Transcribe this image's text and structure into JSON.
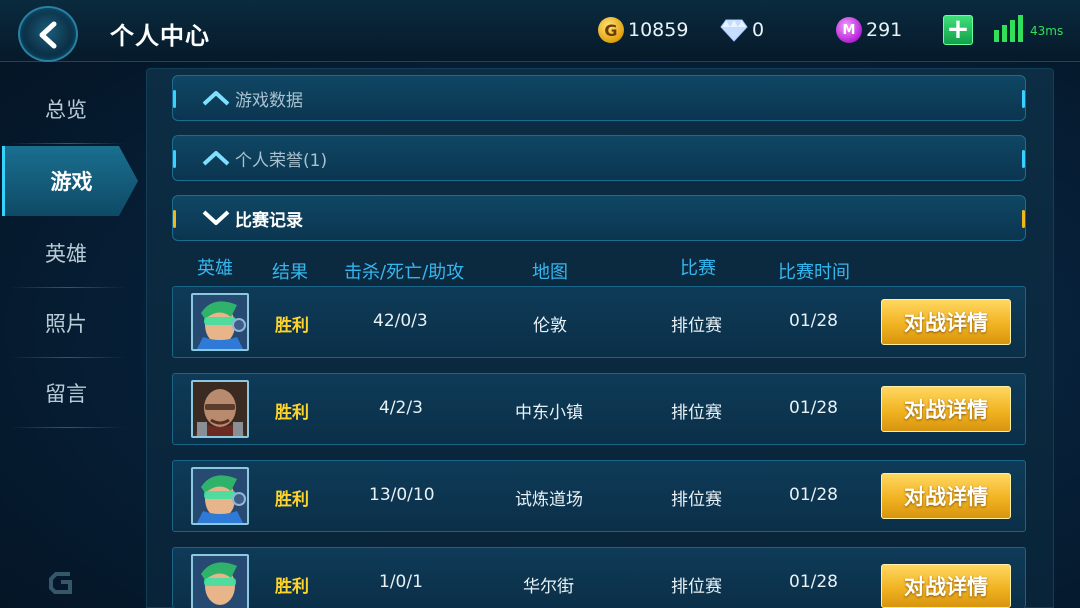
{
  "header": {
    "title": "个人中心",
    "gold": "10859",
    "diamonds": "0",
    "crystals": "291",
    "ping": "43ms"
  },
  "sidebar": {
    "items": [
      {
        "label": "总览"
      },
      {
        "label": "游戏"
      },
      {
        "label": "英雄"
      },
      {
        "label": "照片"
      },
      {
        "label": "留言"
      }
    ],
    "active": "游戏"
  },
  "sections": {
    "game_data": "游戏数据",
    "honors": "个人荣誉(1)",
    "match_history": "比赛记录"
  },
  "table": {
    "columns": [
      "英雄",
      "结果",
      "击杀/死亡/助攻",
      "地图",
      "比赛",
      "比赛时间"
    ],
    "detail_button_label": "对战详情",
    "rows": [
      {
        "hero": "green-visor-hero",
        "result": "胜利",
        "kda": "42/0/3",
        "map": "伦敦",
        "mode": "排位赛",
        "date": "01/28"
      },
      {
        "hero": "bald-brawler-hero",
        "result": "胜利",
        "kda": "4/2/3",
        "map": "中东小镇",
        "mode": "排位赛",
        "date": "01/28"
      },
      {
        "hero": "green-visor-hero",
        "result": "胜利",
        "kda": "13/0/10",
        "map": "试炼道场",
        "mode": "排位赛",
        "date": "01/28"
      },
      {
        "hero": "green-visor-hero",
        "result": "胜利",
        "kda": "1/0/1",
        "map": "华尔街",
        "mode": "排位赛",
        "date": "01/28"
      }
    ]
  },
  "colors": {
    "accent_cyan": "#35b6ee",
    "win_yellow": "#ffd42a",
    "button_gold": "#f1b321",
    "signal_green": "#30e05a"
  }
}
